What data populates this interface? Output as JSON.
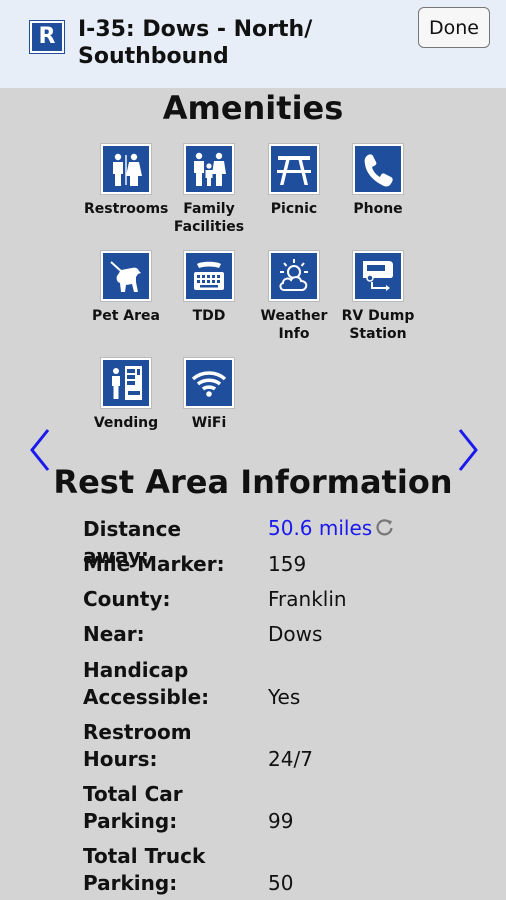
{
  "header": {
    "logo_letter": "R",
    "title": "I-35: Dows - North/ Southbound",
    "done_label": "Done"
  },
  "amenities": {
    "heading": "Amenities",
    "items": [
      {
        "label": "Restrooms",
        "icon": "restrooms-icon"
      },
      {
        "label": "Family Facilities",
        "icon": "family-facilities-icon"
      },
      {
        "label": "Picnic",
        "icon": "picnic-icon"
      },
      {
        "label": "Phone",
        "icon": "phone-icon"
      },
      {
        "label": "Pet Area",
        "icon": "pet-area-icon"
      },
      {
        "label": "TDD",
        "icon": "tdd-icon"
      },
      {
        "label": "Weather Info",
        "icon": "weather-info-icon"
      },
      {
        "label": "RV Dump Station",
        "icon": "rv-dump-icon"
      },
      {
        "label": "Vending",
        "icon": "vending-icon"
      },
      {
        "label": "WiFi",
        "icon": "wifi-icon"
      }
    ]
  },
  "nav": {
    "prev_icon": "chevron-left-icon",
    "next_icon": "chevron-right-icon",
    "color": "#1a1aee"
  },
  "info": {
    "heading": "Rest Area Information",
    "rows": [
      {
        "key": "Distance away:",
        "value": "50.6 miles"
      },
      {
        "key": "Mile Marker:",
        "value": "159"
      },
      {
        "key": "County:",
        "value": "Franklin"
      },
      {
        "key": "Near:",
        "value": "Dows"
      },
      {
        "key": "Handicap Accessible:",
        "value": "Yes"
      },
      {
        "key": "Restroom Hours:",
        "value": "24/7"
      },
      {
        "key": "Total Car Parking:",
        "value": "99"
      },
      {
        "key": "Total Truck Parking:",
        "value": "50"
      }
    ]
  },
  "colors": {
    "sign_blue": "#1f4e9c",
    "link_blue": "#1a1aee",
    "background": "#d4d4d4",
    "header_bg": "#e8eef7"
  }
}
